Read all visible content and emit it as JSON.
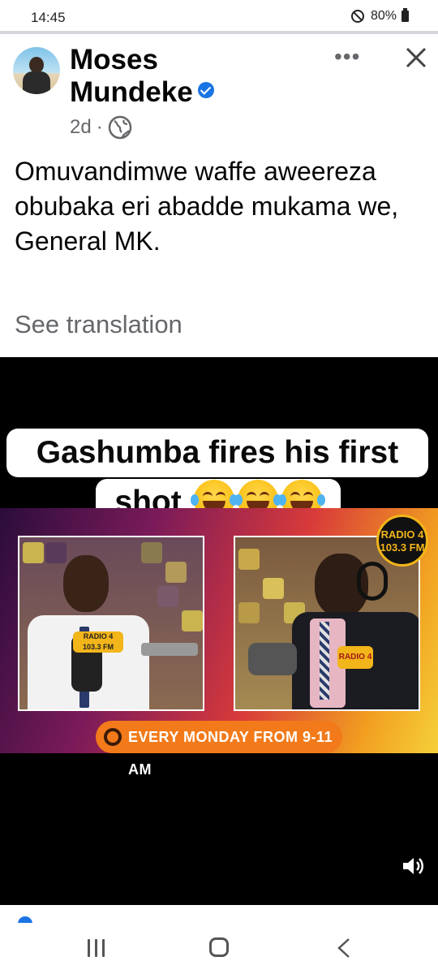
{
  "status_bar": {
    "time": "14:45",
    "battery": "80%"
  },
  "post": {
    "author": "Moses Mundeke",
    "author_line1": "Moses",
    "author_line2": "Mundeke",
    "verified": true,
    "age": "2d",
    "separator": "·",
    "audience_icon": "globe-icon",
    "text": "Omuvandimwe waffe aweereza obubaka eri abadde mukama we, General MK.",
    "see_translation": "See translation"
  },
  "video": {
    "caption_line1": "Gashumba fires his first",
    "caption_line2": "shot",
    "emoji": "face-with-tears-of-joy",
    "banner_text": "EVERY MONDAY FROM 9-11 AM",
    "logo_text": "RADIO 4",
    "logo_freq": "103.3 FM"
  },
  "icons": {
    "more": "more-options-icon",
    "close": "close-icon",
    "sound": "speaker-icon"
  },
  "colors": {
    "verified_blue": "#1b74e4",
    "banner_orange": "#f27a1a",
    "secondary_text": "#65676b"
  }
}
